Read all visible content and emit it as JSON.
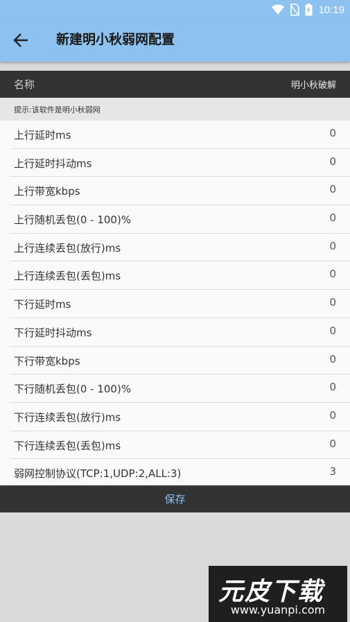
{
  "status_bar": {
    "time": "10:19",
    "icons": [
      "wifi-icon",
      "no-sim-icon",
      "battery-icon"
    ]
  },
  "app_bar": {
    "title": "新建明小秋弱网配置",
    "back_icon": "arrow-left-icon"
  },
  "header": {
    "name_label": "名称",
    "name_value": "明小秋破解"
  },
  "hint": "提示:该软件是明小秋弱网",
  "settings": [
    {
      "label": "上行延时ms",
      "value": "0"
    },
    {
      "label": "上行延时抖动ms",
      "value": "0"
    },
    {
      "label": "上行带宽kbps",
      "value": "0"
    },
    {
      "label": "上行随机丢包(0 - 100)%",
      "value": "0"
    },
    {
      "label": "上行连续丢包(放行)ms",
      "value": "0"
    },
    {
      "label": "上行连续丢包(丢包)ms",
      "value": "0"
    },
    {
      "label": "下行延时ms",
      "value": "0"
    },
    {
      "label": "下行延时抖动ms",
      "value": "0"
    },
    {
      "label": "下行带宽kbps",
      "value": "0"
    },
    {
      "label": "下行随机丢包(0 - 100)%",
      "value": "0"
    },
    {
      "label": "下行连续丢包(放行)ms",
      "value": "0"
    },
    {
      "label": "下行连续丢包(丢包)ms",
      "value": "0"
    },
    {
      "label": "弱网控制协议(TCP:1,UDP:2,ALL:3)",
      "value": "3"
    }
  ],
  "save_label": "保存",
  "watermark": {
    "brand": "元皮下载",
    "url": "www.yuanpi.com"
  },
  "colors": {
    "accent": "#8dc1ef",
    "dark_bar": "#333333"
  }
}
